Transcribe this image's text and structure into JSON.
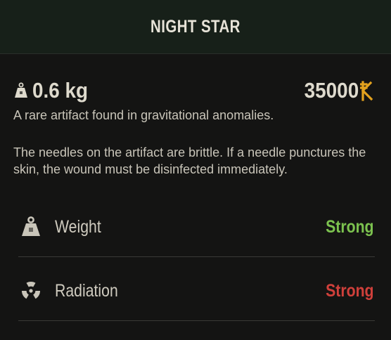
{
  "item": {
    "name": "NIGHT STAR",
    "weight": "0.6 kg",
    "price": "35000",
    "description_1": "A rare artifact found in gravitational anomalies.",
    "description_2": "The needles on the artifact are brittle. If a needle punctures the skin, the wound must be disinfected immediately."
  },
  "icons": {
    "weight": "weight-icon",
    "currency": "coupon-currency-icon",
    "radiation": "radiation-icon"
  },
  "properties": [
    {
      "label": "Weight",
      "value": "Strong",
      "value_color": "#7cc24f"
    },
    {
      "label": "Radiation",
      "value": "Strong",
      "value_color": "#d0403b"
    }
  ],
  "colors": {
    "header_bg": "#172019",
    "panel_bg": "#141413",
    "currency": "#e3a21e",
    "positive": "#7cc24f",
    "negative": "#d0403b"
  }
}
